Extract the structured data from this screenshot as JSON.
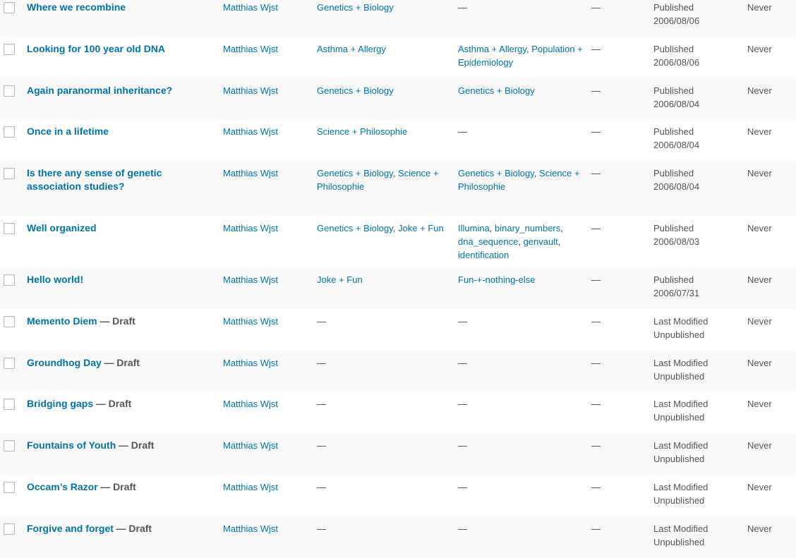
{
  "rows": [
    {
      "title": "Where we recombine",
      "state": "",
      "author": "Matthias Wjst",
      "categories": [
        "Genetics + Biology"
      ],
      "tags": [],
      "comments": "—",
      "date_status": "Published",
      "date_value": "2006/08/06",
      "seo": "Never"
    },
    {
      "title": "Looking for 100 year old DNA",
      "state": "",
      "author": "Matthias Wjst",
      "categories": [
        "Asthma + Allergy"
      ],
      "tags": [
        "Asthma + Allergy",
        "Population + Epidemiology"
      ],
      "comments": "—",
      "date_status": "Published",
      "date_value": "2006/08/06",
      "seo": "Never"
    },
    {
      "title": "Again paranormal inheritance?",
      "state": "",
      "author": "Matthias Wjst",
      "categories": [
        "Genetics + Biology"
      ],
      "tags": [
        "Genetics + Biology"
      ],
      "comments": "—",
      "date_status": "Published",
      "date_value": "2006/08/04",
      "seo": "Never"
    },
    {
      "title": "Once in a lifetime",
      "state": "",
      "author": "Matthias Wjst",
      "categories": [
        "Science + Philosophie"
      ],
      "tags": [],
      "comments": "—",
      "date_status": "Published",
      "date_value": "2006/08/04",
      "seo": "Never"
    },
    {
      "title": "Is there any sense of genetic association studies?",
      "state": "",
      "author": "Matthias Wjst",
      "categories": [
        "Genetics + Biology",
        "Science + Philosophie"
      ],
      "tags": [
        "Genetics + Biology",
        "Science + Philosophie"
      ],
      "comments": "—",
      "date_status": "Published",
      "date_value": "2006/08/04",
      "seo": "Never"
    },
    {
      "title": "Well organized",
      "state": "",
      "author": "Matthias Wjst",
      "categories": [
        "Genetics + Biology",
        "Joke + Fun"
      ],
      "tags": [
        "Illumina",
        "binary_numbers",
        "dna_sequence",
        "genvault",
        "identification"
      ],
      "comments": "—",
      "date_status": "Published",
      "date_value": "2006/08/03",
      "seo": "Never"
    },
    {
      "title": "Hello world!",
      "state": "",
      "author": "Matthias Wjst",
      "categories": [
        "Joke + Fun"
      ],
      "tags": [
        "Fun-+-nothing-else"
      ],
      "comments": "—",
      "date_status": "Published",
      "date_value": "2006/07/31",
      "seo": "Never"
    },
    {
      "title": "Memento Diem",
      "state": "— Draft",
      "author": "Matthias Wjst",
      "categories": [],
      "tags": [],
      "comments": "—",
      "date_status": "Last Modified",
      "date_value": "Unpublished",
      "seo": "Never"
    },
    {
      "title": "Groundhog Day",
      "state": "— Draft",
      "author": "Matthias Wjst",
      "categories": [],
      "tags": [],
      "comments": "—",
      "date_status": "Last Modified",
      "date_value": "Unpublished",
      "seo": "Never"
    },
    {
      "title": "Bridging gaps",
      "state": "— Draft",
      "author": "Matthias Wjst",
      "categories": [],
      "tags": [],
      "comments": "—",
      "date_status": "Last Modified",
      "date_value": "Unpublished",
      "seo": "Never"
    },
    {
      "title": "Fountains of Youth",
      "state": "— Draft",
      "author": "Matthias Wjst",
      "categories": [],
      "tags": [],
      "comments": "—",
      "date_status": "Last Modified",
      "date_value": "Unpublished",
      "seo": "Never"
    },
    {
      "title": "Occam’s Razor",
      "state": "— Draft",
      "author": "Matthias Wjst",
      "categories": [],
      "tags": [],
      "comments": "—",
      "date_status": "Last Modified",
      "date_value": "Unpublished",
      "seo": "Never"
    },
    {
      "title": "Forgive and forget",
      "state": "— Draft",
      "author": "Matthias Wjst",
      "categories": [],
      "tags": [],
      "comments": "—",
      "date_status": "Last Modified",
      "date_value": "Unpublished",
      "seo": "Never"
    }
  ],
  "empty_marker": "—",
  "list_separator": ", "
}
